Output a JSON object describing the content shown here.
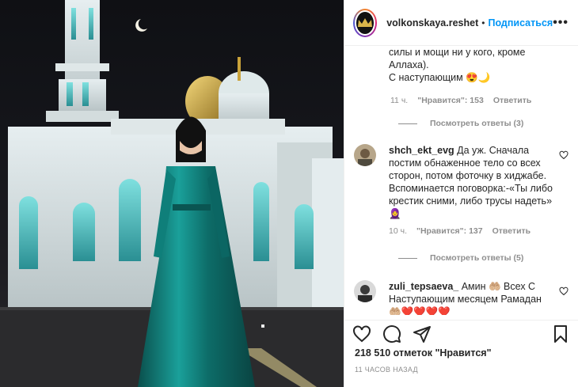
{
  "header": {
    "username": "volkonskaya.reshet",
    "separator": "•",
    "follow_label": "Подписаться",
    "more_label": "•••"
  },
  "comments": {
    "first": {
      "lines": [
        "силы и мощи ни у кого, кроме",
        "Аллаха).",
        "С наступающим 😍🌙"
      ],
      "time": "11 ч.",
      "likes": "\"Нравится\": 153",
      "reply_label": "Ответить",
      "view_replies": "Посмотреть ответы (3)"
    },
    "second": {
      "username": "shch_ekt_evg",
      "text": " Да уж. Сначала постим обнаженное тело со всех сторон, потом фоточку в хиджабе. Вспоминается поговорка:-«Ты либо крестик сними, либо трусы надеть» 🧕",
      "time": "10 ч.",
      "likes": "\"Нравится\": 137",
      "reply_label": "Ответить",
      "view_replies": "Посмотреть ответы (5)"
    },
    "third": {
      "username": "zuli_tepsaeva_",
      "text": " Амин 🤲🏼 Всех С Наступающим месяцем Рамадан 🤲🏼❤️❤️❤️❤️"
    }
  },
  "post": {
    "likes": "218 510 отметок \"Нравится\"",
    "date": "11 ЧАСОВ НАЗАД"
  },
  "colors": {
    "accent": "#0095f6",
    "muted": "#8e8e8e",
    "text": "#262626",
    "dress": "#0f7f7a",
    "dome": "#c9a23a"
  },
  "icons": [
    "more-icon",
    "heart-icon",
    "comment-icon",
    "share-icon",
    "save-icon",
    "like-comment-icon"
  ]
}
